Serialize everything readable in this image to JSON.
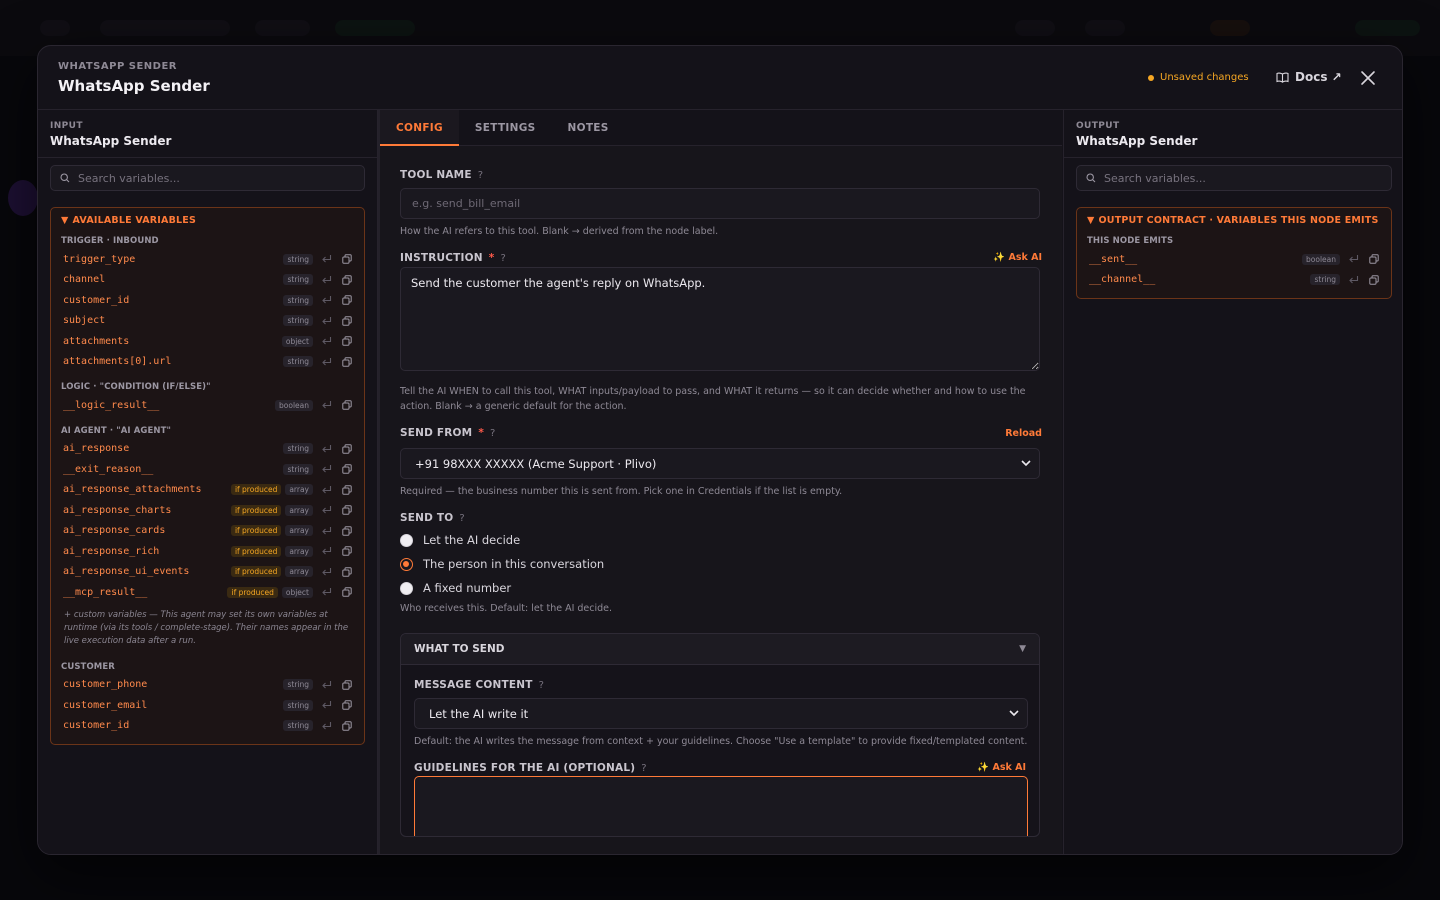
{
  "modal": {
    "kicker": "WHATSAPP SENDER",
    "title": "WhatsApp Sender",
    "unsaved": "Unsaved changes",
    "docs": "Docs ↗"
  },
  "input_panel": {
    "kicker": "INPUT",
    "title": "WhatsApp Sender",
    "search_placeholder": "Search variables...",
    "box_title": "AVAILABLE VARIABLES",
    "groups": [
      {
        "label": "TRIGGER · INBOUND",
        "vars": [
          {
            "name": "trigger_type",
            "type": "string"
          },
          {
            "name": "channel",
            "type": "string"
          },
          {
            "name": "customer_id",
            "type": "string"
          },
          {
            "name": "subject",
            "type": "string"
          },
          {
            "name": "attachments",
            "type": "object"
          },
          {
            "name": "attachments[0].url",
            "type": "string"
          }
        ]
      },
      {
        "label": "LOGIC · \"CONDITION (IF/ELSE)\"",
        "vars": [
          {
            "name": "__logic_result__",
            "type": "boolean"
          }
        ]
      },
      {
        "label": "AI AGENT · \"AI AGENT\"",
        "vars": [
          {
            "name": "ai_response",
            "type": "string"
          },
          {
            "name": "__exit_reason__",
            "type": "string"
          },
          {
            "name": "ai_response_attachments",
            "type": "array",
            "flag": "if produced"
          },
          {
            "name": "ai_response_charts",
            "type": "array",
            "flag": "if produced"
          },
          {
            "name": "ai_response_cards",
            "type": "array",
            "flag": "if produced"
          },
          {
            "name": "ai_response_rich",
            "type": "array",
            "flag": "if produced"
          },
          {
            "name": "ai_response_ui_events",
            "type": "array",
            "flag": "if produced"
          },
          {
            "name": "__mcp_result__",
            "type": "object",
            "flag": "if produced"
          }
        ]
      },
      {
        "label": "CUSTOMER",
        "vars": [
          {
            "name": "customer_phone",
            "type": "string"
          },
          {
            "name": "customer_email",
            "type": "string"
          },
          {
            "name": "customer_id",
            "type": "string"
          }
        ]
      }
    ],
    "custom_note": "+ custom variables — This agent may set its own variables at runtime (via its tools / complete-stage). Their names appear in the live execution data after a run."
  },
  "tabs": [
    "CONFIG",
    "SETTINGS",
    "NOTES"
  ],
  "config": {
    "tool_name_label": "TOOL NAME",
    "tool_name_placeholder": "e.g. send_bill_email",
    "tool_name_help": "How the AI refers to this tool. Blank → derived from the node label.",
    "instruction_label": "INSTRUCTION",
    "ask_ai": "✨ Ask AI",
    "instruction_value": "Send the customer the agent's reply on WhatsApp.",
    "instruction_help": "Tell the AI WHEN to call this tool, WHAT inputs/payload to pass, and WHAT it returns — so it can decide whether and how to use the action. Blank → a generic default for the action.",
    "send_from_label": "SEND FROM",
    "reload": "Reload",
    "send_from_value": "+91 98XXX XXXXX (Acme Support · Plivo)",
    "send_from_help": "Required — the business number this is sent from. Pick one in Credentials if the list is empty.",
    "send_to_label": "SEND TO",
    "send_to_options": [
      "Let the AI decide",
      "The person in this conversation",
      "A fixed number"
    ],
    "send_to_selected": 1,
    "send_to_help": "Who receives this. Default: let the AI decide.",
    "what_to_send_title": "WHAT TO SEND",
    "message_content_label": "MESSAGE CONTENT",
    "message_content_value": "Let the AI write it",
    "message_content_help": "Default: the AI writes the message from context + your guidelines. Choose \"Use a template\" to provide fixed/templated content.",
    "guidelines_label": "GUIDELINES FOR THE AI (OPTIONAL)"
  },
  "output_panel": {
    "kicker": "OUTPUT",
    "title": "WhatsApp Sender",
    "search_placeholder": "Search variables...",
    "box_title": "OUTPUT CONTRACT · VARIABLES THIS NODE EMITS",
    "group_label": "THIS NODE EMITS",
    "vars": [
      {
        "name": "__sent__",
        "type": "boolean"
      },
      {
        "name": "__channel__",
        "type": "string"
      }
    ]
  },
  "colors": {
    "accent": "#ff7a38",
    "warning": "#f5a623",
    "required": "#ff5a4a"
  }
}
